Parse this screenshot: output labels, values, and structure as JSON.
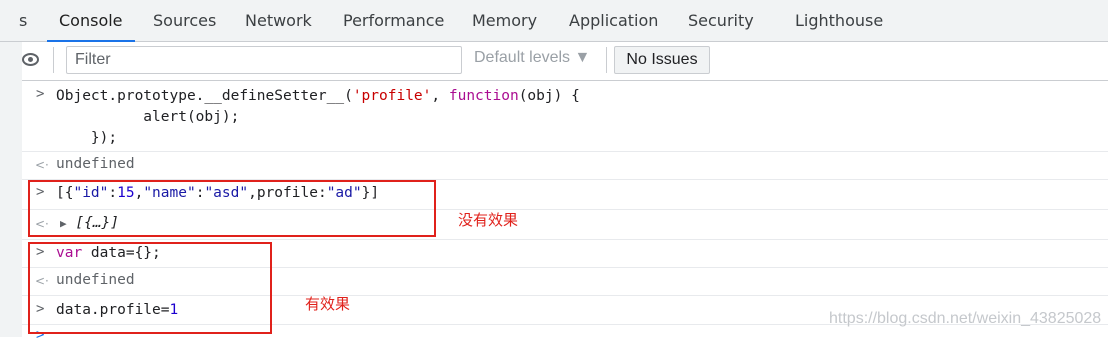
{
  "tabs": [
    {
      "label": "Console",
      "active": true
    },
    {
      "label": "Sources"
    },
    {
      "label": "Network"
    },
    {
      "label": "Performance"
    },
    {
      "label": "Memory"
    },
    {
      "label": "Application"
    },
    {
      "label": "Security"
    },
    {
      "label": "Lighthouse"
    }
  ],
  "tab_fragment": "s",
  "toolbar": {
    "filter_placeholder": "Filter",
    "levels_label": "Default levels ▼",
    "issues_label": "No Issues"
  },
  "console": {
    "prompt_glyph": ">",
    "return_glyph": "<·",
    "entry1": {
      "line1_a": "Object.prototype.__defineSetter__(",
      "line1_str": "'profile'",
      "line1_b": ", ",
      "line1_kw": "function",
      "line1_c": "(obj) {",
      "line2": "          alert(obj);",
      "line3": "    });"
    },
    "result1": "undefined",
    "entry2": {
      "p1": "[{",
      "k1": "\"id\"",
      "p2": ":",
      "n1": "15",
      "p3": ",",
      "k2": "\"name\"",
      "p4": ":",
      "s1": "\"asd\"",
      "p5": ",profile:",
      "s2": "\"ad\"",
      "p6": "}]"
    },
    "result2": "[{…}]",
    "entry3": {
      "kw": "var",
      "rest": " data={};"
    },
    "result3": "undefined",
    "entry4": {
      "a": "data.profile=",
      "n": "1"
    }
  },
  "annotations": {
    "no_effect": "没有效果",
    "has_effect": "有效果",
    "color": "#e0211b"
  },
  "watermark": "https://blog.csdn.net/weixin_43825028"
}
